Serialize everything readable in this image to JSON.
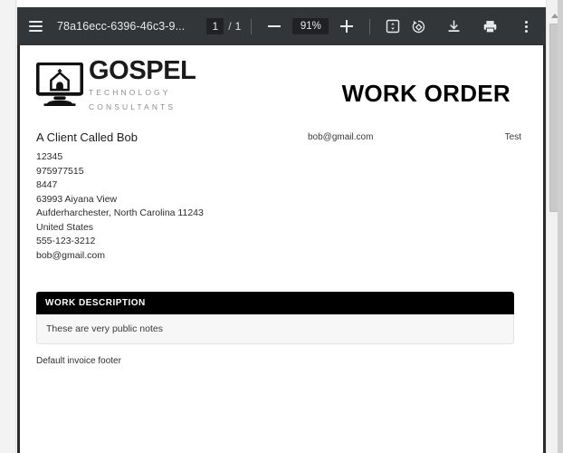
{
  "toolbar": {
    "menu_icon": "hamburger-menu-icon",
    "document_title": "78a16ecc-6396-46c3-9...",
    "page_current": "1",
    "page_separator": "/",
    "page_total": "1",
    "zoom_out_icon": "minus-icon",
    "zoom_level": "91%",
    "zoom_in_icon": "plus-icon",
    "fit_page_icon": "fit-to-page-icon",
    "rotate_icon": "rotate-icon",
    "download_icon": "download-icon",
    "print_icon": "print-icon",
    "more_icon": "kebab-menu-icon"
  },
  "document": {
    "brand": {
      "name": "GOSPEL",
      "tagline_line1": "TECHNOLOGY",
      "tagline_line2": "CONSULTANTS",
      "logo_icon": "monitor-church-logo-icon"
    },
    "doc_type": "WORK ORDER",
    "bill_to": {
      "name": "A Client Called Bob",
      "lines": [
        "12345",
        "975977515",
        "8447",
        "63993 Aiyana View",
        "Aufderharchester, North Carolina 11243",
        "United States",
        "555-123-3212",
        "bob@gmail.com"
      ]
    },
    "meta": {
      "email": "bob@gmail.com",
      "reference": "Test"
    },
    "work_description": {
      "heading": "WORK DESCRIPTION",
      "body": "These are very public notes"
    },
    "footer": "Default invoice footer"
  },
  "colors": {
    "toolbar_bg": "#323639",
    "section_header_bg": "#000000",
    "section_body_bg": "#f7f7f7",
    "page_bg": "#ffffff"
  }
}
